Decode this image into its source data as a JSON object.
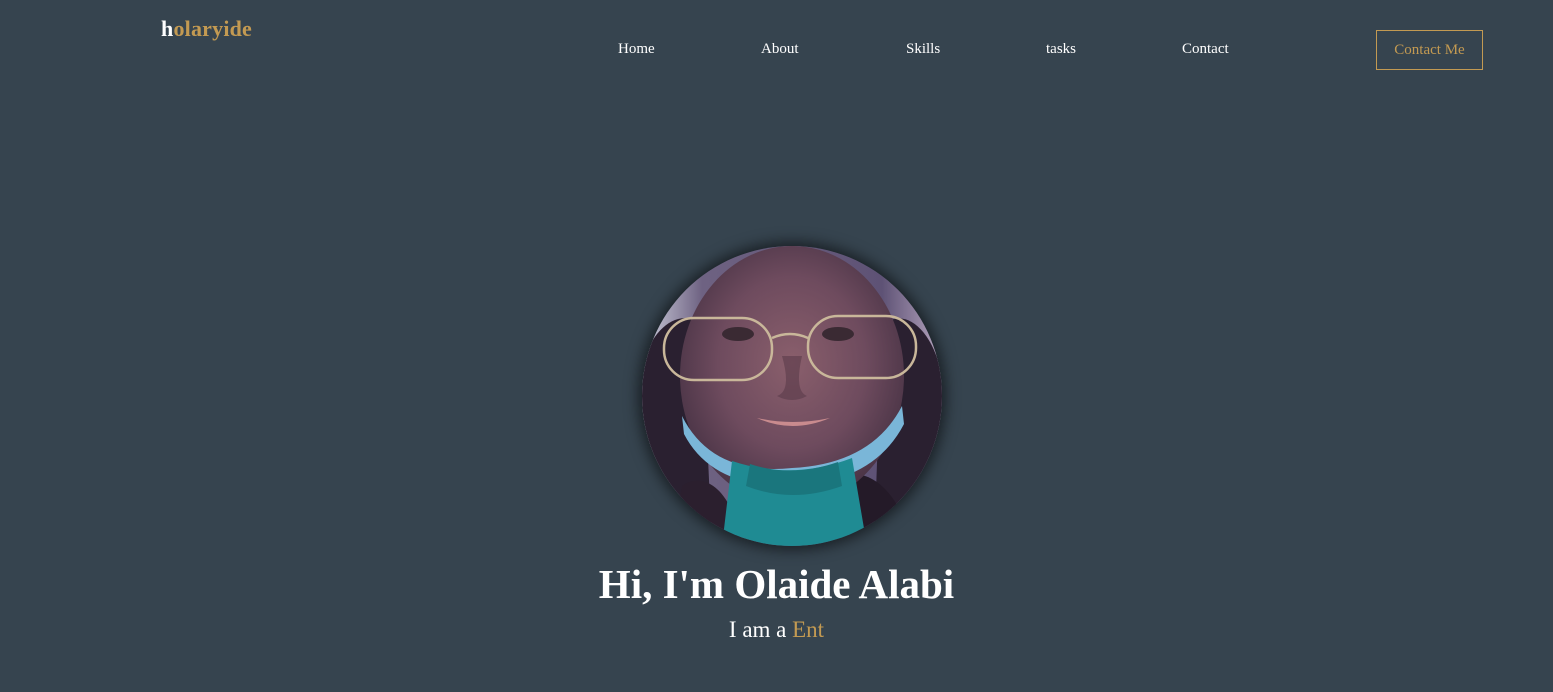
{
  "header": {
    "logo_first_letter": "h",
    "logo_rest": "olaryide"
  },
  "nav": {
    "items": [
      {
        "label": "Home"
      },
      {
        "label": "About"
      },
      {
        "label": "Skills"
      },
      {
        "label": "tasks"
      },
      {
        "label": "Contact"
      }
    ],
    "cta_label": "Contact Me"
  },
  "hero": {
    "title": "Hi, I'm Olaide Alabi",
    "subtitle_prefix": "I am a",
    "subtitle_typed": "Ent"
  },
  "colors": {
    "background": "#36444f",
    "accent": "#c39a52",
    "text": "#ffffff"
  }
}
